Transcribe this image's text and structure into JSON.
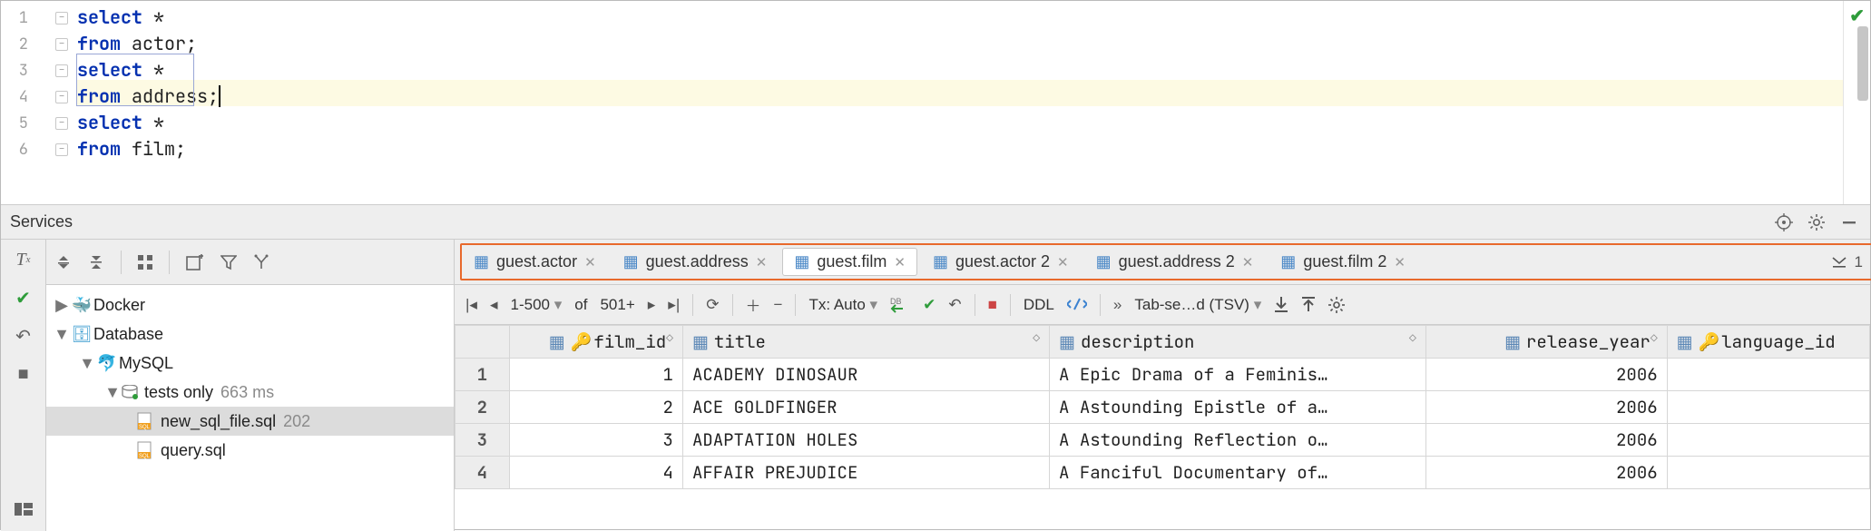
{
  "editor": {
    "lines": [
      {
        "n": "1",
        "kw": "select",
        "rest": " *"
      },
      {
        "n": "2",
        "kw": "from",
        "rest": " actor;"
      },
      {
        "n": "3",
        "kw": "select",
        "rest": " *"
      },
      {
        "n": "4",
        "kw": "from",
        "rest": " address;"
      },
      {
        "n": "5",
        "kw": "select",
        "rest": " *"
      },
      {
        "n": "6",
        "kw": "from",
        "rest": " film;"
      }
    ]
  },
  "services": {
    "title": "Services"
  },
  "tree": {
    "toolbar": {
      "tx": "Tx"
    },
    "nodes": {
      "docker": "Docker",
      "database": "Database",
      "mysql": "MySQL",
      "tests": "tests only",
      "tests_time": "663 ms",
      "file1": "new_sql_file.sql",
      "file1_meta": "202",
      "file2": "query.sql"
    }
  },
  "tabs": [
    {
      "label": "guest.actor",
      "active": false
    },
    {
      "label": "guest.address",
      "active": false
    },
    {
      "label": "guest.film",
      "active": true
    },
    {
      "label": "guest.actor 2",
      "active": false
    },
    {
      "label": "guest.address 2",
      "active": false
    },
    {
      "label": "guest.film 2",
      "active": false
    }
  ],
  "tabs_end_count": "1",
  "result_toolbar": {
    "page_range": "1-500",
    "of": "of",
    "total": "501+",
    "tx": "Tx: Auto",
    "ddl": "DDL",
    "format": "Tab-se…d (TSV)"
  },
  "columns": {
    "film_id": "film_id",
    "title": "title",
    "description": "description",
    "release_year": "release_year",
    "language_id": "language_id"
  },
  "rows": [
    {
      "n": "1",
      "film_id": "1",
      "title": "ACADEMY DINOSAUR",
      "description": "A Epic Drama of a Feminis…",
      "release_year": "2006",
      "language_id": ""
    },
    {
      "n": "2",
      "film_id": "2",
      "title": "ACE GOLDFINGER",
      "description": "A Astounding Epistle of a…",
      "release_year": "2006",
      "language_id": ""
    },
    {
      "n": "3",
      "film_id": "3",
      "title": "ADAPTATION HOLES",
      "description": "A Astounding Reflection o…",
      "release_year": "2006",
      "language_id": ""
    },
    {
      "n": "4",
      "film_id": "4",
      "title": "AFFAIR PREJUDICE",
      "description": "A Fanciful Documentary of…",
      "release_year": "2006",
      "language_id": ""
    }
  ],
  "chart_data": {
    "type": "table",
    "title": "guest.film",
    "columns": [
      "film_id",
      "title",
      "description",
      "release_year",
      "language_id"
    ],
    "rows": [
      [
        1,
        "ACADEMY DINOSAUR",
        "A Epic Drama of a Feminis…",
        2006,
        null
      ],
      [
        2,
        "ACE GOLDFINGER",
        "A Astounding Epistle of a…",
        2006,
        null
      ],
      [
        3,
        "ADAPTATION HOLES",
        "A Astounding Reflection o…",
        2006,
        null
      ],
      [
        4,
        "AFFAIR PREJUDICE",
        "A Fanciful Documentary of…",
        2006,
        null
      ]
    ]
  }
}
